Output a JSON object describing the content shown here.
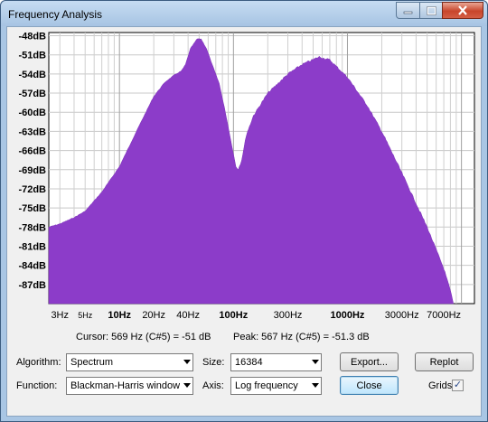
{
  "window": {
    "title": "Frequency Analysis"
  },
  "chart_data": {
    "type": "area",
    "ylabels": [
      "-48dB",
      "-51dB",
      "-54dB",
      "-57dB",
      "-60dB",
      "-63dB",
      "-66dB",
      "-69dB",
      "-72dB",
      "-75dB",
      "-78dB",
      "-81dB",
      "-84dB",
      "-87dB"
    ],
    "bold_ylabels": [
      "-48dB",
      "-60dB",
      "-72dB",
      "-84dB"
    ],
    "xlabels": [
      "3Hz",
      "5Hz",
      "10Hz",
      "20Hz",
      "40Hz",
      "100Hz",
      "300Hz",
      "1000Hz",
      "3000Hz",
      "7000Hz"
    ],
    "bold_xlabels": [
      "10Hz",
      "100Hz",
      "1000Hz"
    ],
    "small_xlabels": [
      "5Hz"
    ],
    "ylim": [
      -90,
      -47.5
    ],
    "xlim_hz": [
      2.4,
      13000
    ],
    "x_scale": "log",
    "grid": true,
    "fill_color": "#8c3cc9",
    "spectrum": [
      [
        2.4,
        -78.0
      ],
      [
        3,
        -77.5
      ],
      [
        4,
        -76.5
      ],
      [
        5,
        -75.5
      ],
      [
        7,
        -72.5
      ],
      [
        10,
        -68.5
      ],
      [
        15,
        -62
      ],
      [
        20,
        -57.5
      ],
      [
        25,
        -55.3
      ],
      [
        30,
        -54.2
      ],
      [
        35,
        -53.5
      ],
      [
        38,
        -52.5
      ],
      [
        42,
        -50
      ],
      [
        48,
        -48.5
      ],
      [
        52,
        -48.5
      ],
      [
        58,
        -50
      ],
      [
        65,
        -52.5
      ],
      [
        75,
        -55.5
      ],
      [
        85,
        -60
      ],
      [
        95,
        -64.5
      ],
      [
        105,
        -68.5
      ],
      [
        110,
        -69
      ],
      [
        118,
        -67.5
      ],
      [
        130,
        -63.5
      ],
      [
        150,
        -60.5
      ],
      [
        200,
        -57
      ],
      [
        300,
        -54
      ],
      [
        400,
        -52.5
      ],
      [
        567,
        -51.3
      ],
      [
        700,
        -51.8
      ],
      [
        1000,
        -54.5
      ],
      [
        1500,
        -59
      ],
      [
        2000,
        -63
      ],
      [
        3000,
        -69.5
      ],
      [
        5000,
        -78
      ],
      [
        7000,
        -84.5
      ],
      [
        8000,
        -88
      ],
      [
        8500,
        -90
      ]
    ]
  },
  "readouts": {
    "cursor": "Cursor: 569 Hz (C#5) = -51 dB",
    "peak": "Peak: 567 Hz (C#5) = -51.3 dB"
  },
  "controls": {
    "algorithm_label": "Algorithm:",
    "algorithm_value": "Spectrum",
    "size_label": "Size:",
    "size_value": "16384",
    "export_label": "Export...",
    "replot_label": "Replot",
    "function_label": "Function:",
    "function_value": "Blackman-Harris window",
    "axis_label": "Axis:",
    "axis_value": "Log frequency",
    "close_label": "Close",
    "grids_label": "Grids",
    "grids_checked": true
  }
}
